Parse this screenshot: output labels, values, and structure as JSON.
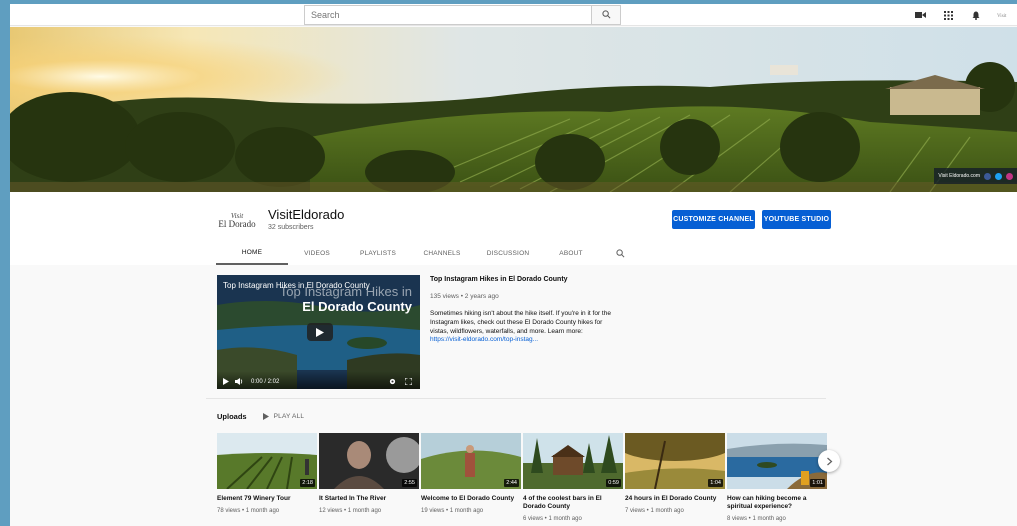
{
  "header": {
    "search_placeholder": "Search"
  },
  "banner": {
    "credit": "Visit Eldorado.com"
  },
  "channel": {
    "name": "VisitEldorado",
    "subscribers": "32 subscribers",
    "avatar_line1": "Visit",
    "avatar_line2": "El Dorado",
    "customize_label": "CUSTOMIZE CHANNEL",
    "studio_label": "YOUTUBE STUDIO",
    "tabs": [
      "HOME",
      "VIDEOS",
      "PLAYLISTS",
      "CHANNELS",
      "DISCUSSION",
      "ABOUT"
    ],
    "active_tab": "HOME"
  },
  "featured": {
    "overlay_title": "Top Instagram Hikes in El Dorado County",
    "overlay_big1": "Top Instagram Hikes in",
    "overlay_big2": "El Dorado County",
    "time": "0:00 / 2:02",
    "title": "Top Instagram Hikes in El Dorado County",
    "meta": "135 views • 2 years ago",
    "description": "Sometimes hiking isn't about the hike itself.  If you're in it for the Instagram likes, check out these El Dorado County hikes for vistas, wildflowers, waterfalls, and more. Learn more:",
    "link": "https://visit-eldorado.com/top-instag..."
  },
  "uploads": {
    "heading": "Uploads",
    "play_all": "PLAY ALL",
    "videos": [
      {
        "title": "Element 79 Winery Tour",
        "meta": "78 views • 1 month ago",
        "duration": "2:18"
      },
      {
        "title": "It Started In The River",
        "meta": "12 views • 1 month ago",
        "duration": "2:55"
      },
      {
        "title": "Welcome to El Dorado County",
        "meta": "19 views • 1 month ago",
        "duration": "2:44"
      },
      {
        "title": "4 of the coolest bars in El Dorado County",
        "meta": "6 views • 1 month ago",
        "duration": "0:59"
      },
      {
        "title": "24 hours in El Dorado County",
        "meta": "7 views • 1 month ago",
        "duration": "1:04"
      },
      {
        "title": "How can hiking become a spiritual experience?",
        "meta": "8 views • 1 month ago",
        "duration": "1:01"
      }
    ]
  },
  "icons": {
    "search": "search-icon",
    "create": "video-camera-icon",
    "apps": "apps-grid-icon",
    "notifications": "bell-icon",
    "next": "chevron-right-icon"
  },
  "colors": {
    "accent": "#065fd4",
    "frame": "#5f9ec0"
  }
}
